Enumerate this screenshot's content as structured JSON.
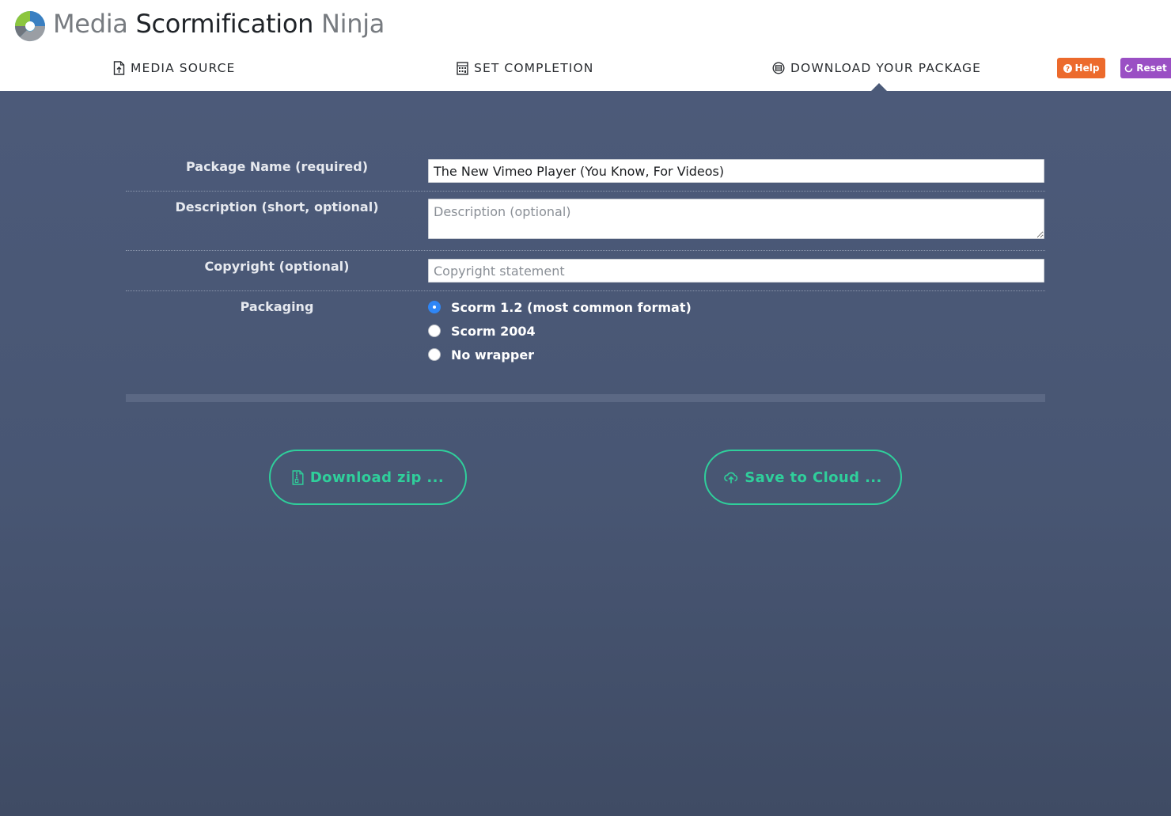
{
  "header": {
    "title_part1": "Media",
    "title_part2": "Scormification",
    "title_part3": "Ninja",
    "tabs": [
      {
        "label": "MEDIA SOURCE",
        "icon": "file-upload-icon"
      },
      {
        "label": "SET COMPLETION",
        "icon": "calculator-icon"
      },
      {
        "label": "DOWNLOAD YOUR PACKAGE",
        "icon": "package-icon",
        "active": true
      }
    ],
    "help_label": "Help",
    "reset_label": "Reset",
    "colors": {
      "help": "#ec6a2c",
      "reset": "#9a4fc4"
    }
  },
  "form": {
    "package_name": {
      "label": "Package Name (required)",
      "value": "The New Vimeo Player (You Know, For Videos)"
    },
    "description": {
      "label": "Description (short, optional)",
      "placeholder": "Description (optional)",
      "value": ""
    },
    "copyright": {
      "label": "Copyright (optional)",
      "placeholder": "Copyright statement",
      "value": ""
    },
    "packaging": {
      "label": "Packaging",
      "options": [
        {
          "label": "Scorm 1.2 (most common format)",
          "checked": true
        },
        {
          "label": "Scorm 2004",
          "checked": false
        },
        {
          "label": "No wrapper",
          "checked": false
        }
      ]
    }
  },
  "progress": 0,
  "actions": {
    "download_label": "Download zip ...",
    "cloud_label": "Save to Cloud ...",
    "accent_color": "#2fcf9b"
  },
  "colors": {
    "background": "#4b5a78",
    "radio_checked": "#2f86f6"
  }
}
